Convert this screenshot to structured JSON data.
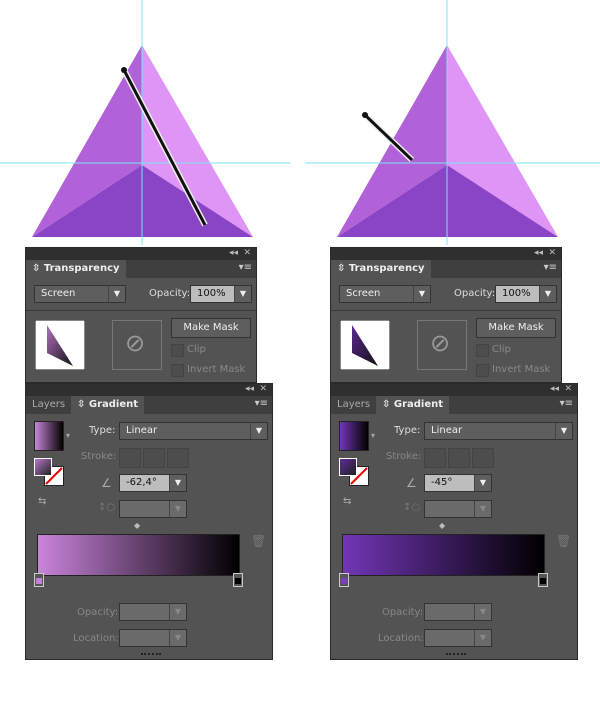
{
  "panels": [
    {
      "angle": "-62,4°",
      "grad_start": "#c984db",
      "swatch_thumb": "#b877cc",
      "stop_left_color": "#c47fd6"
    },
    {
      "angle": "-45°",
      "grad_start": "#7236b6",
      "swatch_thumb": "#5d2a99",
      "stop_left_color": "#7a40c0"
    }
  ],
  "transparency": {
    "title": "Transparency",
    "blend_mode": "Screen",
    "opacity_label": "Opacity:",
    "opacity_value": "100%",
    "make_mask": "Make Mask",
    "clip": "Clip",
    "invert_mask": "Invert Mask"
  },
  "gradient": {
    "tab_layers": "Layers",
    "tab_gradient": "Gradient",
    "type_label": "Type:",
    "type_value": "Linear",
    "stroke_label": "Stroke:",
    "opacity_label": "Opacity:",
    "location_label": "Location:"
  },
  "colors": {
    "face_left": "#b262d8",
    "face_right": "#de95f6",
    "face_bottom": "#8a44c6",
    "guide": "#7fe3f0",
    "panel": "#535353"
  }
}
